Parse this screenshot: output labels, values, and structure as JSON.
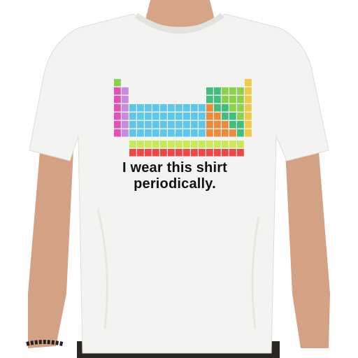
{
  "caption": {
    "line1": "I wear this shirt",
    "line2": "periodically."
  },
  "colors": {
    "background": "#ffffff",
    "shirt": "#f3f3f1",
    "skin": "#d6a587",
    "caption_text": "#111111",
    "alkali_metals": "#e84fb5",
    "alkaline_earth": "#c68be8",
    "transition_metals": "#5cc6ec",
    "post_transition": "#f08a3a",
    "metalloids": "#3fbf7a",
    "nonmetals": "#8ad24a",
    "noble_gases": "#f0c84a",
    "lanthanides": "#c9ea52",
    "actinides": "#f04646"
  }
}
